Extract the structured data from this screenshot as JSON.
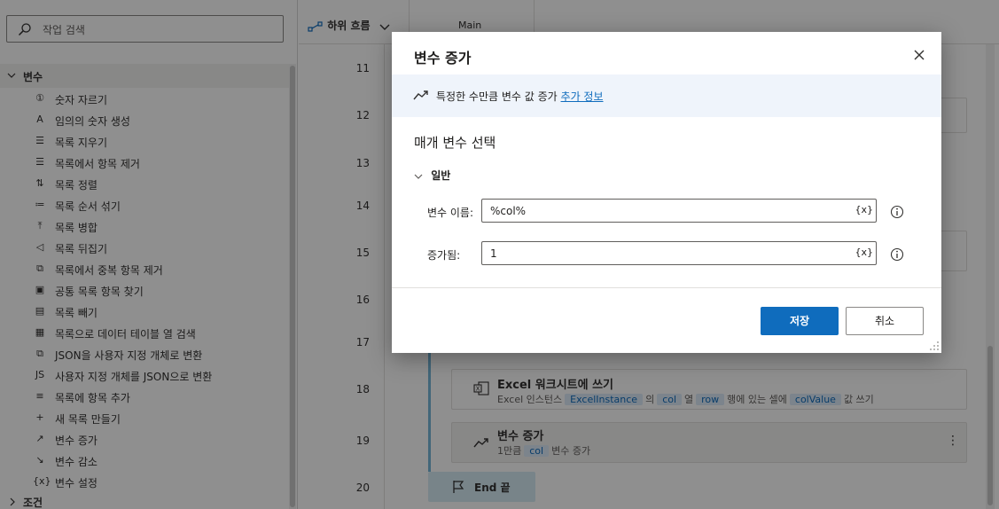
{
  "search": {
    "placeholder": "작업 검색"
  },
  "actions_panel": {
    "group_label": "변수",
    "next_group_label": "조건",
    "items": [
      {
        "icon": "round-number-icon",
        "glyph": "①",
        "label": "숫자 자르기"
      },
      {
        "icon": "random-number-icon",
        "glyph": "A",
        "label": "임의의 숫자 생성"
      },
      {
        "icon": "clear-list-icon",
        "glyph": "☰",
        "label": "목록 지우기"
      },
      {
        "icon": "remove-list-item-icon",
        "glyph": "☰",
        "label": "목록에서 항목 제거"
      },
      {
        "icon": "sort-list-icon",
        "glyph": "⇅",
        "label": "목록 정렬"
      },
      {
        "icon": "shuffle-list-icon",
        "glyph": "≔",
        "label": "목록 순서 섞기"
      },
      {
        "icon": "merge-lists-icon",
        "glyph": "⤒",
        "label": "목록 병합"
      },
      {
        "icon": "reverse-list-icon",
        "glyph": "◁",
        "label": "목록 뒤집기"
      },
      {
        "icon": "remove-duplicates-icon",
        "glyph": "⧉",
        "label": "목록에서 중복 항목 제거"
      },
      {
        "icon": "common-items-icon",
        "glyph": "▣",
        "label": "공통 목록 항목 찾기"
      },
      {
        "icon": "subtract-lists-icon",
        "glyph": "▤",
        "label": "목록 빼기"
      },
      {
        "icon": "datatable-search-icon",
        "glyph": "▦",
        "label": "목록으로 데이터 테이블 열 검색"
      },
      {
        "icon": "json-to-object-icon",
        "glyph": "⧉",
        "label": "JSON을 사용자 지정 개체로 변환"
      },
      {
        "icon": "object-to-json-icon",
        "glyph": "JS",
        "label": "사용자 지정 개체를 JSON으로 변환"
      },
      {
        "icon": "add-list-item-icon",
        "glyph": "≡",
        "label": "목록에 항목 추가"
      },
      {
        "icon": "new-list-icon",
        "glyph": "+",
        "label": "새 목록 만들기"
      },
      {
        "icon": "increase-variable-icon",
        "glyph": "↗",
        "label": "변수 증가"
      },
      {
        "icon": "decrease-variable-icon",
        "glyph": "↘",
        "label": "변수 감소"
      },
      {
        "icon": "set-variable-icon",
        "glyph": "{x}",
        "label": "변수 설정"
      }
    ]
  },
  "designer": {
    "subflows_label": "하위 흐름",
    "main_tab": "Main",
    "line_numbers": [
      "11",
      "12",
      "13",
      "14",
      "15",
      "16",
      "17",
      "18",
      "19",
      "20"
    ],
    "excel_step": {
      "title": "Excel 워크시트에 쓰기",
      "prefix": "Excel 인스턴스",
      "instance": "ExcelInstance",
      "p1": "의",
      "col": "col",
      "p2": "열",
      "row": "row",
      "p3": "행에 있는 셀에",
      "value": "colValue",
      "p4": "값 쓰기"
    },
    "increase_step": {
      "title": "변수 증가",
      "amount": "1만큼",
      "var": "col",
      "suffix": "변수 증가"
    },
    "end_label": "End 끝"
  },
  "dialog": {
    "title": "변수 증가",
    "description": "특정한 수만큼 변수 값 증가",
    "more_info": "추가 정보",
    "section_title": "매개 변수 선택",
    "group_label": "일반",
    "fields": [
      {
        "label": "변수 이름:",
        "value": "%col%",
        "var_button": "{x}"
      },
      {
        "label": "증가됨:",
        "value": "1",
        "var_button": "{x}"
      }
    ],
    "save_label": "저장",
    "cancel_label": "취소"
  }
}
